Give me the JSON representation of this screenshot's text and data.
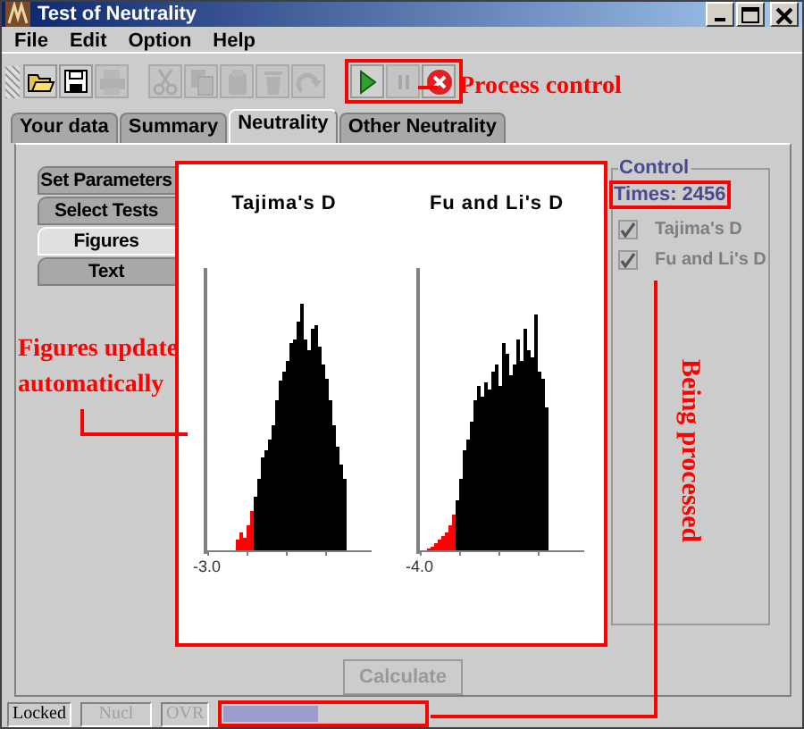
{
  "window": {
    "title": "Test of Neutrality"
  },
  "menu": [
    {
      "label": "File"
    },
    {
      "label": "Edit"
    },
    {
      "label": "Option"
    },
    {
      "label": "Help"
    }
  ],
  "toolbar": [
    {
      "kind": "open",
      "disabled": false
    },
    {
      "kind": "save",
      "disabled": false
    },
    {
      "kind": "print",
      "disabled": true
    },
    {
      "kind": "cut",
      "disabled": true
    },
    {
      "kind": "copy",
      "disabled": true
    },
    {
      "kind": "paste",
      "disabled": true
    },
    {
      "kind": "delete",
      "disabled": true
    },
    {
      "kind": "redo",
      "disabled": true
    }
  ],
  "process_controls": [
    {
      "kind": "play",
      "disabled": false
    },
    {
      "kind": "pause",
      "disabled": true
    },
    {
      "kind": "stop",
      "disabled": false
    }
  ],
  "tabs": [
    {
      "label": "Your data",
      "selected": false
    },
    {
      "label": "Summary",
      "selected": false
    },
    {
      "label": "Neutrality",
      "selected": true
    },
    {
      "label": "Other Neutrality",
      "selected": false
    }
  ],
  "side_tabs": [
    {
      "label": "Set Parameters",
      "selected": false
    },
    {
      "label": "Select Tests",
      "selected": false
    },
    {
      "label": "Figures",
      "selected": true
    },
    {
      "label": "Text",
      "selected": false
    }
  ],
  "figures": [
    {
      "title": "Tajima's D",
      "x_tick": "-3.0"
    },
    {
      "title": "Fu and Li's D",
      "x_tick": "-4.0"
    }
  ],
  "control": {
    "title": "Control",
    "times": "Times: 2456",
    "checks": [
      {
        "label": "Tajima's D",
        "checked": true,
        "disabled": true
      },
      {
        "label": "Fu and Li's D",
        "checked": true,
        "disabled": true
      }
    ]
  },
  "calculate": {
    "label": "Calculate",
    "disabled": true
  },
  "status_bar": {
    "fields": [
      {
        "text": "Locked",
        "disabled": false
      },
      {
        "text": "Nucl",
        "disabled": true
      },
      {
        "text": "OVR",
        "disabled": true
      }
    ],
    "progress": {
      "level": 0.47
    }
  },
  "annotations": [
    {
      "kind": "process",
      "text": "Process control"
    },
    {
      "kind": "figures",
      "text": "Figures update automatically"
    },
    {
      "kind": "processing",
      "text": "Being processed"
    }
  ]
}
